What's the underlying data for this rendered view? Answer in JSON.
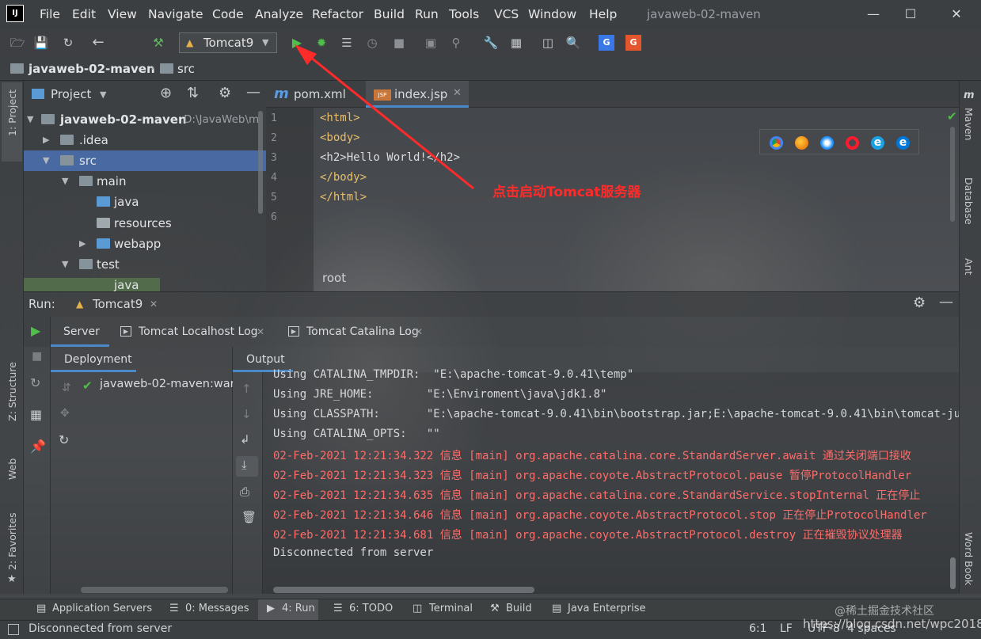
{
  "window": {
    "title": "javaweb-02-maven",
    "logo_text": "IJ",
    "menu": [
      "File",
      "Edit",
      "View",
      "Navigate",
      "Code",
      "Analyze",
      "Refactor",
      "Build",
      "Run",
      "Tools",
      "VCS",
      "Window",
      "Help"
    ]
  },
  "toolbar": {
    "run_config": "Tomcat9"
  },
  "breadcrumb": [
    "javaweb-02-maven",
    "src"
  ],
  "left_strip": [
    "1: Project",
    "Z: Structure",
    "Web",
    "2: Favorites"
  ],
  "right_strip": [
    "Maven",
    "Database",
    "Ant",
    "Word Book"
  ],
  "project": {
    "header": "Project",
    "tree": [
      {
        "label": "javaweb-02-maven",
        "extra": "D:\\JavaWeb\\m",
        "bold": true
      },
      {
        "label": ".idea"
      },
      {
        "label": "src"
      },
      {
        "label": "main"
      },
      {
        "label": "java"
      },
      {
        "label": "resources"
      },
      {
        "label": "webapp"
      },
      {
        "label": "test"
      },
      {
        "label": "java"
      }
    ]
  },
  "editor": {
    "tabs": [
      "pom.xml",
      "index.jsp"
    ],
    "tab_badges": {
      "m": "m",
      "jsp": "JSP"
    },
    "line_numbers": [
      "1",
      "2",
      "3",
      "4",
      "5",
      "6"
    ],
    "lines": [
      "<html>",
      "<body>",
      "<h2>Hello World!</h2>",
      "</body>",
      "</html>",
      ""
    ],
    "breadcrumb": "root",
    "annotation": "点击启动Tomcat服务器"
  },
  "run": {
    "label": "Run:",
    "config_tab": "Tomcat9",
    "tabs": [
      "Server",
      "Tomcat Localhost Log",
      "Tomcat Catalina Log"
    ],
    "deployment_header": "Deployment",
    "output_header": "Output",
    "deployment_item": "javaweb-02-maven:war",
    "output_lines": [
      {
        "text": "Using CATALINA_TMPDIR:  \"E:\\apache-tomcat-9.0.41\\temp\"",
        "type": "norm"
      },
      {
        "text": "Using JRE_HOME:        \"E:\\Enviroment\\java\\jdk1.8\"",
        "type": "norm"
      },
      {
        "text": "Using CLASSPATH:       \"E:\\apache-tomcat-9.0.41\\bin\\bootstrap.jar;E:\\apache-tomcat-9.0.41\\bin\\tomcat-juli.jar\"",
        "type": "norm"
      },
      {
        "text": "Using CATALINA_OPTS:   \"\"",
        "type": "norm"
      },
      {
        "text": "02-Feb-2021 12:21:34.322 信息 [main] org.apache.catalina.core.StandardServer.await 通过关闭端口接收",
        "type": "err"
      },
      {
        "text": "02-Feb-2021 12:21:34.323 信息 [main] org.apache.coyote.AbstractProtocol.pause 暂停ProtocolHandler",
        "type": "err"
      },
      {
        "text": "02-Feb-2021 12:21:34.635 信息 [main] org.apache.catalina.core.StandardService.stopInternal 正在停止",
        "type": "err"
      },
      {
        "text": "02-Feb-2021 12:21:34.646 信息 [main] org.apache.coyote.AbstractProtocol.stop 正在停止ProtocolHandler",
        "type": "err"
      },
      {
        "text": "02-Feb-2021 12:21:34.681 信息 [main] org.apache.coyote.AbstractProtocol.destroy 正在摧毁协议处理器",
        "type": "err"
      },
      {
        "text": "Disconnected from server",
        "type": "norm"
      }
    ]
  },
  "bottom_tabs": [
    "Application Servers",
    "0: Messages",
    "4: Run",
    "6: TODO",
    "Terminal",
    "Build",
    "Java Enterprise"
  ],
  "status": {
    "message": "Disconnected from server",
    "position": "6:1",
    "line_sep": "LF",
    "encoding": "UTF-8",
    "indent": "4 spaces",
    "watermark1": "@稀土掘金技术社区",
    "watermark2": "https://blog.csdn.net/wpc2018"
  },
  "colors": {
    "annotation": "#ff2a2a",
    "selection": "#4b6eaf",
    "error_text": "#ff6b68",
    "run_green": "#4fbf4a"
  }
}
